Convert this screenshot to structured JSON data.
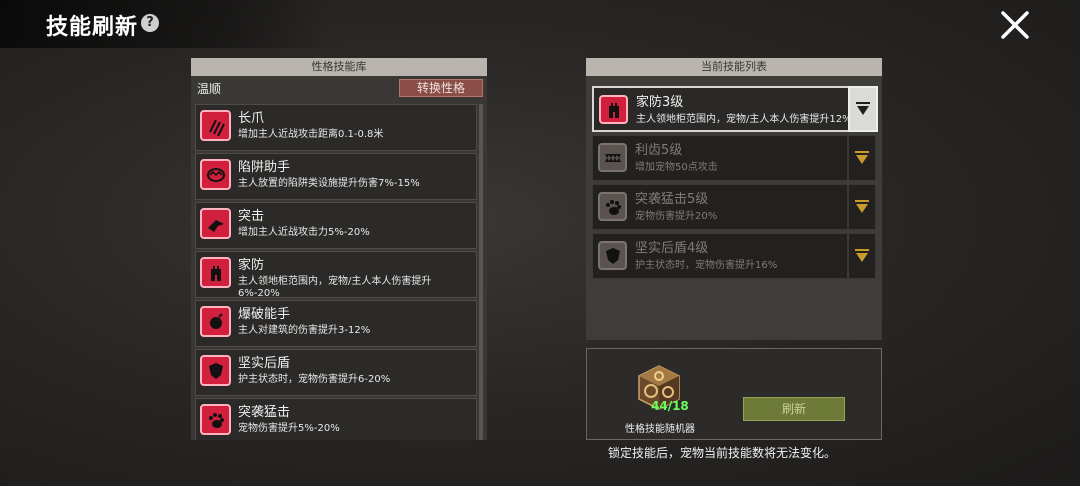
{
  "header": {
    "title": "技能刷新",
    "help_glyph": "?"
  },
  "left": {
    "header": "性格技能库",
    "temperament": "温顺",
    "switch_label": "转换性格",
    "skills": [
      {
        "name": "长爪",
        "desc": "增加主人近战攻击距离0.1-0.8米",
        "icon": "claw-icon"
      },
      {
        "name": "陷阱助手",
        "desc": "主人放置的陷阱类设施提升伤害7%-15%",
        "icon": "trap-icon"
      },
      {
        "name": "突击",
        "desc": "增加主人近战攻击力5%-20%",
        "icon": "assault-icon"
      },
      {
        "name": "家防",
        "desc": "主人领地柜范围内，宠物/主人本人伤害提升6%-20%",
        "icon": "tower-icon"
      },
      {
        "name": "爆破能手",
        "desc": "主人对建筑的伤害提升3-12%",
        "icon": "bomb-icon"
      },
      {
        "name": "坚实后盾",
        "desc": "护主状态时，宠物伤害提升6-20%",
        "icon": "shield-icon"
      },
      {
        "name": "突袭猛击",
        "desc": "宠物伤害提升5%-20%",
        "icon": "paw-icon"
      }
    ]
  },
  "right": {
    "header": "当前技能列表",
    "skills": [
      {
        "name": "家防3级",
        "desc": "主人领地柜范围内，宠物/主人本人伤害提升12%",
        "icon": "tower-icon",
        "active": true
      },
      {
        "name": "利齿5级",
        "desc": "增加宠物50点攻击",
        "icon": "teeth-icon",
        "active": false
      },
      {
        "name": "突袭猛击5级",
        "desc": "宠物伤害提升20%",
        "icon": "paw-icon",
        "active": false
      },
      {
        "name": "坚实后盾4级",
        "desc": "护主状态时，宠物伤害提升16%",
        "icon": "shield-icon",
        "active": false
      }
    ]
  },
  "randomizer": {
    "label": "性格技能随机器",
    "count": "44/18",
    "refresh_label": "刷新",
    "icon": "cube-icon"
  },
  "footnote": "锁定技能后，宠物当前技能数将无法变化。",
  "colors": {
    "skill_red": "#d0203e",
    "refresh_green": "#6e7a37",
    "counter_green": "#6aff5a"
  }
}
